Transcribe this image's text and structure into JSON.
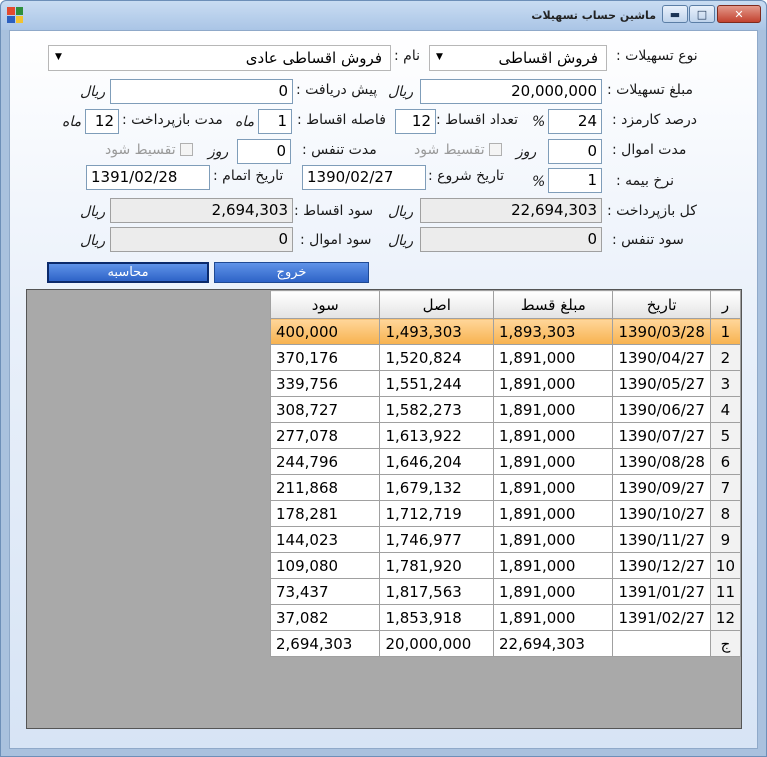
{
  "window": {
    "title": "ماشین حساب تسهیلات"
  },
  "form": {
    "loan_type_label": "نوع تسهیلات :",
    "loan_type_value": "فروش اقساطی",
    "name_label": "نام :",
    "name_value": "فروش اقساطی عادی",
    "loan_amount_label": "مبلغ تسهیلات :",
    "loan_amount_value": "20,000,000",
    "loan_amount_unit": "ریال",
    "prepay_label": "پیش دریافت :",
    "prepay_value": "0",
    "prepay_unit": "ریال",
    "fee_label": "درصد کارمزد :",
    "fee_value": "24",
    "fee_unit": "%",
    "count_label": "تعداد اقساط :",
    "count_value": "12",
    "interval_label": "فاصله اقساط :",
    "interval_value": "1",
    "interval_unit": "ماه",
    "repay_label": "مدت بازپرداخت :",
    "repay_value": "12",
    "repay_unit": "ماه",
    "amwal_label": "مدت اموال :",
    "amwal_value": "0",
    "amwal_unit": "روز",
    "amwal_check": "تقسیط شود",
    "tanaffos_label": "مدت تنفس :",
    "tanaffos_value": "0",
    "tanaffos_unit": "روز",
    "tanaffos_check": "تقسیط شود",
    "insurance_label": "نرخ بیمه :",
    "insurance_value": "1",
    "insurance_unit": "%",
    "start_label": "تاریخ شروع :",
    "start_value": "1390/02/27",
    "end_label": "تاریخ اتمام :",
    "end_value": "1391/02/28",
    "total_label": "کل بازپرداخت :",
    "total_value": "22,694,303",
    "total_unit": "ریال",
    "inst_profit_label": "سود اقساط :",
    "inst_profit_value": "2,694,303",
    "inst_profit_unit": "ریال",
    "tanaffos_profit_label": "سود تنفس :",
    "tanaffos_profit_value": "0",
    "tanaffos_profit_unit": "ریال",
    "amwal_profit_label": "سود اموال :",
    "amwal_profit_value": "0",
    "amwal_profit_unit": "ریال"
  },
  "buttons": {
    "exit": "خروج",
    "calc": "محاسبه"
  },
  "table": {
    "headers": {
      "rn": "ر",
      "date": "تاریخ",
      "amount": "مبلغ قسط",
      "principal": "اصل",
      "interest": "سود"
    },
    "rows": [
      {
        "rn": "1",
        "date": "1390/03/28",
        "amount": "1,893,303",
        "principal": "1,493,303",
        "interest": "400,000"
      },
      {
        "rn": "2",
        "date": "1390/04/27",
        "amount": "1,891,000",
        "principal": "1,520,824",
        "interest": "370,176"
      },
      {
        "rn": "3",
        "date": "1390/05/27",
        "amount": "1,891,000",
        "principal": "1,551,244",
        "interest": "339,756"
      },
      {
        "rn": "4",
        "date": "1390/06/27",
        "amount": "1,891,000",
        "principal": "1,582,273",
        "interest": "308,727"
      },
      {
        "rn": "5",
        "date": "1390/07/27",
        "amount": "1,891,000",
        "principal": "1,613,922",
        "interest": "277,078"
      },
      {
        "rn": "6",
        "date": "1390/08/28",
        "amount": "1,891,000",
        "principal": "1,646,204",
        "interest": "244,796"
      },
      {
        "rn": "7",
        "date": "1390/09/27",
        "amount": "1,891,000",
        "principal": "1,679,132",
        "interest": "211,868"
      },
      {
        "rn": "8",
        "date": "1390/10/27",
        "amount": "1,891,000",
        "principal": "1,712,719",
        "interest": "178,281"
      },
      {
        "rn": "9",
        "date": "1390/11/27",
        "amount": "1,891,000",
        "principal": "1,746,977",
        "interest": "144,023"
      },
      {
        "rn": "10",
        "date": "1390/12/27",
        "amount": "1,891,000",
        "principal": "1,781,920",
        "interest": "109,080"
      },
      {
        "rn": "11",
        "date": "1391/01/27",
        "amount": "1,891,000",
        "principal": "1,817,563",
        "interest": "73,437"
      },
      {
        "rn": "12",
        "date": "1391/02/27",
        "amount": "1,891,000",
        "principal": "1,853,918",
        "interest": "37,082"
      }
    ],
    "total": {
      "rn": "ج",
      "date": "",
      "amount": "22,694,303",
      "principal": "20,000,000",
      "interest": "2,694,303"
    }
  }
}
